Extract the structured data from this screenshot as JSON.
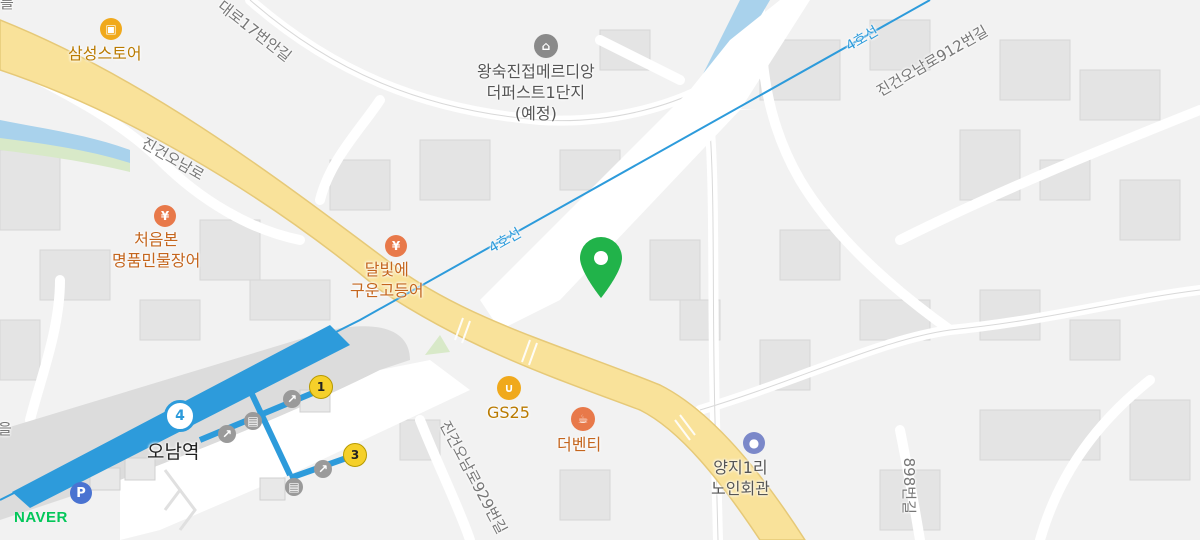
{
  "map": {
    "brand": "NAVER",
    "colors": {
      "background": "#f2f2f2",
      "main_road": "#f9e29a",
      "subway_line4": "#2d9bdb",
      "water": "#a9d2ec",
      "marker": "#21b34a"
    },
    "roads": {
      "main": "진건오남로",
      "r1": "진건오남로912번길",
      "r2": "진건오남로929번길",
      "r3": "898번길",
      "r4": "대로17번안길"
    },
    "subway": {
      "line_label_1": "4호선",
      "line_label_2": "4호선",
      "station_number": "4",
      "station_name": "오남역",
      "exit_1": "1",
      "exit_3": "3"
    },
    "pois": [
      {
        "id": "samsung",
        "name": "삼성스토어",
        "icon": "shopping-bag-icon"
      },
      {
        "id": "apartment",
        "name": "왕숙진접메르디앙\n더퍼스트1단지\n(예정)",
        "icon": "house-icon"
      },
      {
        "id": "cheoeumbon",
        "name": "처음본\n명품민물장어",
        "icon": "restaurant-icon"
      },
      {
        "id": "dalbit",
        "name": "달빛에\n구운고등어",
        "icon": "restaurant-icon"
      },
      {
        "id": "gs25",
        "name": "GS25",
        "icon": "shopping-basket-icon"
      },
      {
        "id": "thebenti",
        "name": "더벤티",
        "icon": "coffee-cup-icon"
      },
      {
        "id": "yangji",
        "name": "양지1리\n노인회관",
        "icon": "circle-dot-icon"
      }
    ],
    "parking": "P",
    "edge_text_top": "를",
    "edge_text_left": "을"
  }
}
